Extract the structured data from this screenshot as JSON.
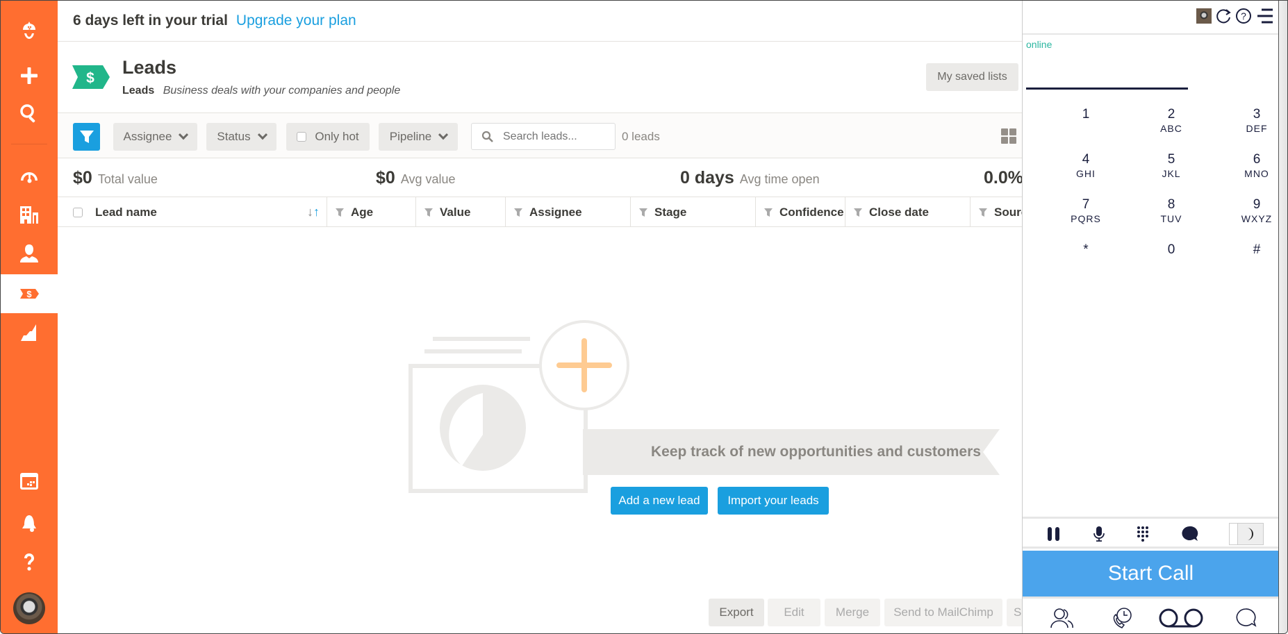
{
  "trial": {
    "text": "6 days left in your trial",
    "link": "Upgrade your plan"
  },
  "sidebar": {
    "items": [
      {
        "name": "logo",
        "icon": "acorn-logo-icon"
      },
      {
        "name": "add",
        "icon": "plus-icon"
      },
      {
        "name": "search",
        "icon": "search-icon"
      },
      {
        "name": "dashboard",
        "icon": "gauge-icon"
      },
      {
        "name": "companies",
        "icon": "building-icon"
      },
      {
        "name": "people",
        "icon": "person-icon"
      },
      {
        "name": "leads",
        "icon": "dollar-tag-icon",
        "active": true
      },
      {
        "name": "reports",
        "icon": "chart-icon"
      },
      {
        "name": "calendar",
        "icon": "calendar-icon"
      },
      {
        "name": "notifications",
        "icon": "bell-icon"
      },
      {
        "name": "help",
        "icon": "question-icon"
      }
    ]
  },
  "page": {
    "title": "Leads",
    "sub_label": "Leads",
    "sub_desc": "Business deals with your companies and people",
    "saved_lists": "My saved lists"
  },
  "toolbar": {
    "assignee": "Assignee",
    "status": "Status",
    "only_hot": "Only hot",
    "pipeline": "Pipeline",
    "search_placeholder": "Search leads...",
    "count": "0 leads"
  },
  "stats": [
    {
      "value": "$0",
      "label": "Total value"
    },
    {
      "value": "$0",
      "label": "Avg value"
    },
    {
      "value": "0 days",
      "label": "Avg time open"
    },
    {
      "value": "0.0%",
      "label": ""
    }
  ],
  "columns": [
    "Lead name",
    "Age",
    "Value",
    "Assignee",
    "Stage",
    "Confidence",
    "Close date",
    "Source"
  ],
  "empty": {
    "message": "Keep track of new opportunities and customers",
    "add": "Add a new lead",
    "import": "Import your leads"
  },
  "bulk": {
    "export": "Export",
    "edit": "Edit",
    "merge": "Merge",
    "mailchimp": "Send to MailChimp",
    "more": "S"
  },
  "phone": {
    "status": "online",
    "keys": [
      {
        "d": "1",
        "l": ""
      },
      {
        "d": "2",
        "l": "ABC"
      },
      {
        "d": "3",
        "l": "DEF"
      },
      {
        "d": "4",
        "l": "GHI"
      },
      {
        "d": "5",
        "l": "JKL"
      },
      {
        "d": "6",
        "l": "MNO"
      },
      {
        "d": "7",
        "l": "PQRS"
      },
      {
        "d": "8",
        "l": "TUV"
      },
      {
        "d": "9",
        "l": "WXYZ"
      },
      {
        "d": "*",
        "l": ""
      },
      {
        "d": "0",
        "l": ""
      },
      {
        "d": "#",
        "l": ""
      }
    ],
    "start_call": "Start Call",
    "colors": {
      "primary": "#4ba4ec",
      "ink": "#1a1e3d",
      "online": "#2bb6a0"
    }
  },
  "colors": {
    "brand": "#ff6e30",
    "accent": "#1a9fdf",
    "lead_green": "#21b68a"
  }
}
